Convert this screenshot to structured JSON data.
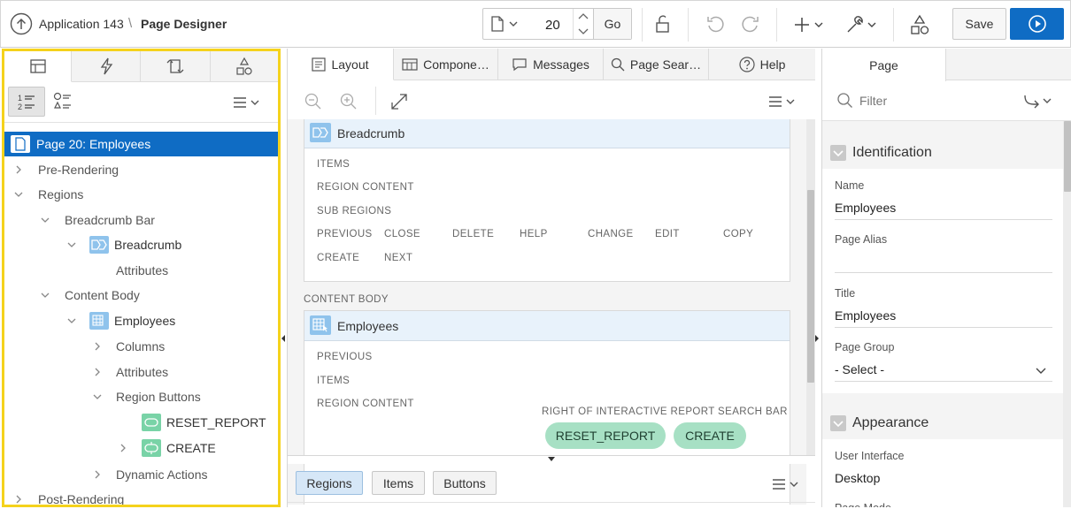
{
  "header": {
    "app_name": "Application 143",
    "separator": "\\",
    "page_title": "Page Designer",
    "page_number": "20",
    "go_label": "Go",
    "save_label": "Save"
  },
  "left_panel": {
    "tabs": [
      "rendering-icon",
      "dynamic-actions-icon",
      "processing-icon",
      "shared-components-icon"
    ],
    "tree": [
      {
        "label": "Page 20: Employees",
        "level": 0,
        "selected": true,
        "icon": "page-icon"
      },
      {
        "label": "Pre-Rendering",
        "level": 0,
        "chevron": "right"
      },
      {
        "label": "Regions",
        "level": 0,
        "chevron": "down"
      },
      {
        "label": "Breadcrumb Bar",
        "level": 1,
        "chevron": "down"
      },
      {
        "label": "Breadcrumb",
        "level": 2,
        "chevron": "down",
        "icon": "breadcrumb-icon"
      },
      {
        "label": "Attributes",
        "level": 3
      },
      {
        "label": "Content Body",
        "level": 1,
        "chevron": "down"
      },
      {
        "label": "Employees",
        "level": 2,
        "chevron": "down",
        "icon": "report-icon"
      },
      {
        "label": "Columns",
        "level": 3,
        "chevron": "right"
      },
      {
        "label": "Attributes",
        "level": 3,
        "chevron": "right"
      },
      {
        "label": "Region Buttons",
        "level": 3,
        "chevron": "down"
      },
      {
        "label": "RESET_REPORT",
        "level": 5,
        "icon": "button-icon"
      },
      {
        "label": "CREATE",
        "level": 5,
        "chevron": "right",
        "icon": "button-action-icon"
      },
      {
        "label": "Dynamic Actions",
        "level": 3,
        "chevron": "right"
      },
      {
        "label": "Post-Rendering",
        "level": 0,
        "chevron": "right"
      }
    ]
  },
  "middle": {
    "tabs": [
      {
        "label": "Layout",
        "icon": "layout-icon"
      },
      {
        "label": "Compone…",
        "icon": "component-icon"
      },
      {
        "label": "Messages",
        "icon": "messages-icon"
      },
      {
        "label": "Page Sear…",
        "icon": "search-icon"
      },
      {
        "label": "Help",
        "icon": "help-icon"
      }
    ],
    "breadcrumb_card": {
      "title": "Breadcrumb",
      "labels": [
        "ITEMS",
        "REGION CONTENT",
        "SUB REGIONS"
      ],
      "positions_row1": [
        "PREVIOUS",
        "CLOSE",
        "DELETE",
        "HELP",
        "CHANGE",
        "EDIT",
        "COPY"
      ],
      "positions_row2": [
        "CREATE",
        "NEXT"
      ]
    },
    "content_body_label": "CONTENT BODY",
    "employees_card": {
      "title": "Employees",
      "labels": [
        "PREVIOUS",
        "ITEMS",
        "REGION CONTENT"
      ],
      "search_bar_label": "RIGHT OF INTERACTIVE REPORT SEARCH BAR",
      "buttons": [
        "RESET_REPORT",
        "CREATE"
      ]
    },
    "subtabs": [
      "Regions",
      "Items",
      "Buttons"
    ]
  },
  "right": {
    "tab": "Page",
    "filter_placeholder": "Filter",
    "identification": {
      "title": "Identification",
      "name_label": "Name",
      "name_value": "Employees",
      "alias_label": "Page Alias",
      "alias_value": "",
      "title_label": "Title",
      "title_value": "Employees",
      "group_label": "Page Group",
      "group_value": "- Select -"
    },
    "appearance": {
      "title": "Appearance",
      "ui_label": "User Interface",
      "ui_value": "Desktop",
      "mode_label": "Page Mode"
    }
  },
  "colors": {
    "primary": "#0f6cc4",
    "highlight_border": "#f5d21c",
    "button_green": "#a7e0c4",
    "region_head": "#e8f2fb"
  }
}
